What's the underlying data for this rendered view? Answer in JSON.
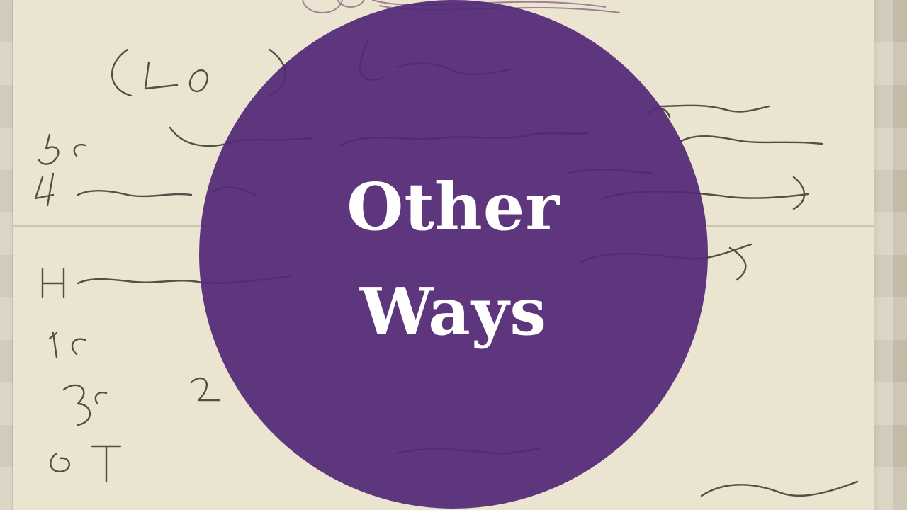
{
  "title": {
    "line1": "Other",
    "line2": "Ways"
  },
  "colors": {
    "circle": "#522976",
    "title_text": "#ffffff",
    "card": "#ebe4d0",
    "ink": "#3a3530",
    "engraving": "#8a6a84"
  },
  "background_icon": "handwritten-recipe-card"
}
